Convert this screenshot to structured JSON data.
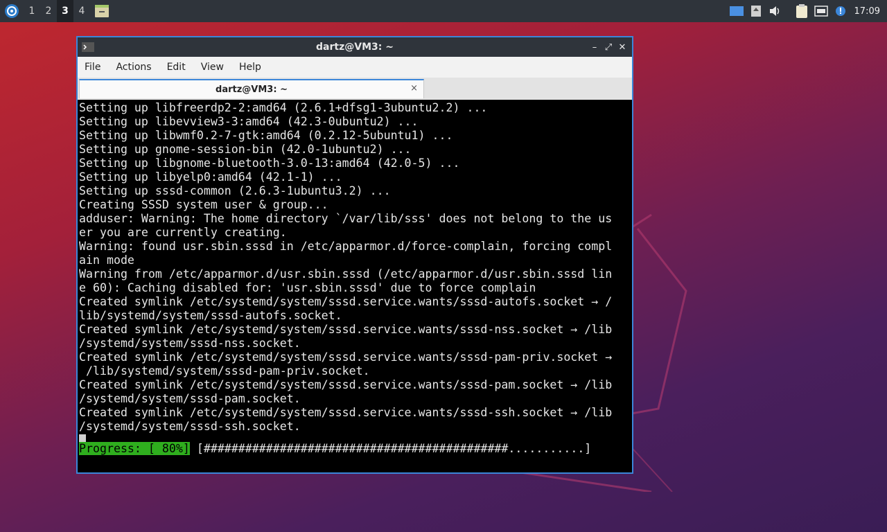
{
  "panel": {
    "workspaces": [
      "1",
      "2",
      "3",
      "4"
    ],
    "active_workspace": "3",
    "clock": "17:09",
    "icons": [
      "xubuntu-logo-icon",
      "files-icon",
      "screen-icon",
      "drive-icon",
      "volume-icon",
      "clipboard-icon",
      "network-icon",
      "notification-icon"
    ]
  },
  "window": {
    "title": "dartz@VM3: ~",
    "menu": [
      "File",
      "Actions",
      "Edit",
      "View",
      "Help"
    ],
    "tab_label": "dartz@VM3: ~",
    "tab_close": "×",
    "controls": {
      "minimize": "–",
      "maximize": "⤢",
      "close": "✕"
    }
  },
  "terminal": {
    "lines": [
      "Setting up libfreerdp2-2:amd64 (2.6.1+dfsg1-3ubuntu2.2) ...",
      "Setting up libevview3-3:amd64 (42.3-0ubuntu2) ...",
      "Setting up libwmf0.2-7-gtk:amd64 (0.2.12-5ubuntu1) ...",
      "Setting up gnome-session-bin (42.0-1ubuntu2) ...",
      "Setting up libgnome-bluetooth-3.0-13:amd64 (42.0-5) ...",
      "Setting up libyelp0:amd64 (42.1-1) ...",
      "Setting up sssd-common (2.6.3-1ubuntu3.2) ...",
      "Creating SSSD system user & group...",
      "adduser: Warning: The home directory `/var/lib/sss' does not belong to the us",
      "er you are currently creating.",
      "Warning: found usr.sbin.sssd in /etc/apparmor.d/force-complain, forcing compl",
      "ain mode",
      "Warning from /etc/apparmor.d/usr.sbin.sssd (/etc/apparmor.d/usr.sbin.sssd lin",
      "e 60): Caching disabled for: 'usr.sbin.sssd' due to force complain",
      "Created symlink /etc/systemd/system/sssd.service.wants/sssd-autofs.socket → /",
      "lib/systemd/system/sssd-autofs.socket.",
      "Created symlink /etc/systemd/system/sssd.service.wants/sssd-nss.socket → /lib",
      "/systemd/system/sssd-nss.socket.",
      "Created symlink /etc/systemd/system/sssd.service.wants/sssd-pam-priv.socket →",
      " /lib/systemd/system/sssd-pam-priv.socket.",
      "Created symlink /etc/systemd/system/sssd.service.wants/sssd-pam.socket → /lib",
      "/systemd/system/sssd-pam.socket.",
      "Created symlink /etc/systemd/system/sssd.service.wants/sssd-ssh.socket → /lib",
      "/systemd/system/sssd-ssh.socket."
    ],
    "progress_label": "Progress: [ 80%]",
    "progress_bar": " [############################################...........]",
    "progress_percent": 80
  },
  "colors": {
    "panel_bg": "#2f343b",
    "window_border": "#3b86d9",
    "progress_green": "#2fae1e",
    "terminal_bg": "#000000"
  }
}
